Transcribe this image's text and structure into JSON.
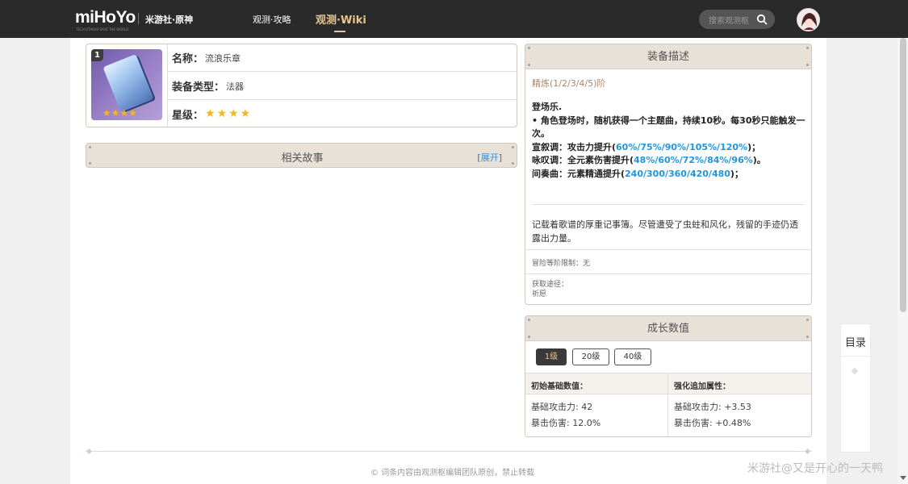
{
  "header": {
    "logo": "miHoYo",
    "logo_sub": "TECH OTAKUS SAVE THE WORLD",
    "brand": "米游社·原神",
    "nav_guide": "观测·攻略",
    "nav_wiki": "观测·Wiki",
    "search_placeholder": "搜索观测枢"
  },
  "item": {
    "level_badge": "1",
    "name_label": "名称：",
    "name_value": "流浪乐章",
    "type_label": "装备类型：",
    "type_value": "法器",
    "rarity_label": "星级：",
    "rarity_stars": 4,
    "stars_text": "★★★★"
  },
  "story": {
    "title": "相关故事",
    "expand_open": "[",
    "expand": "展开",
    "expand_close": "]"
  },
  "description": {
    "title": "装备描述",
    "refine": "精炼(1/2/3/4/5)阶",
    "skill_name": "登场乐.",
    "line1": "• 角色登场时，随机获得一个主题曲，持续10秒。每30秒只能触发一次。",
    "line2_prefix": "宣叙调：攻击力提升(",
    "line2_values": "60%/75%/90%/105%/120%",
    "line2_suffix": ")；",
    "line3_prefix": "咏叹调：全元素伤害提升(",
    "line3_values": "48%/60%/72%/84%/96%",
    "line3_suffix": ")。",
    "line4_prefix": "间奏曲：元素精通提升(",
    "line4_values": "240/300/360/420/480",
    "line4_suffix": ")；",
    "flavor": "记载着歌谱的厚重记事簿。尽管遭受了虫蛀和风化，残留的手迹仍透露出力量。",
    "limit": "冒险等阶限制：无",
    "acquire_label": "获取途径：",
    "acquire_value": "祈愿"
  },
  "growth": {
    "title": "成长数值",
    "levels": [
      "1级",
      "20级",
      "40级"
    ],
    "active_level": "1级",
    "base_header": "初始基础数值：",
    "bonus_header": "强化追加属性：",
    "base_atk": "基础攻击力: 42",
    "base_crit": "暴击伤害: 12.0%",
    "bonus_atk": "基础攻击力: +3.53",
    "bonus_crit": "暴击伤害: +0.48%"
  },
  "toc": {
    "title": "目录"
  },
  "footer": {
    "text": "词条内容由观测枢编辑团队原创，禁止转载",
    "copyright_symbol": "©"
  },
  "watermark": "米游社@又是开心的一天鸭",
  "colors": {
    "topbar": "#2a2a2a",
    "accent_gold": "#e6c58f",
    "panel_header": "#e8e1d8",
    "link_blue": "#2196d8",
    "star": "#f5b51d"
  }
}
